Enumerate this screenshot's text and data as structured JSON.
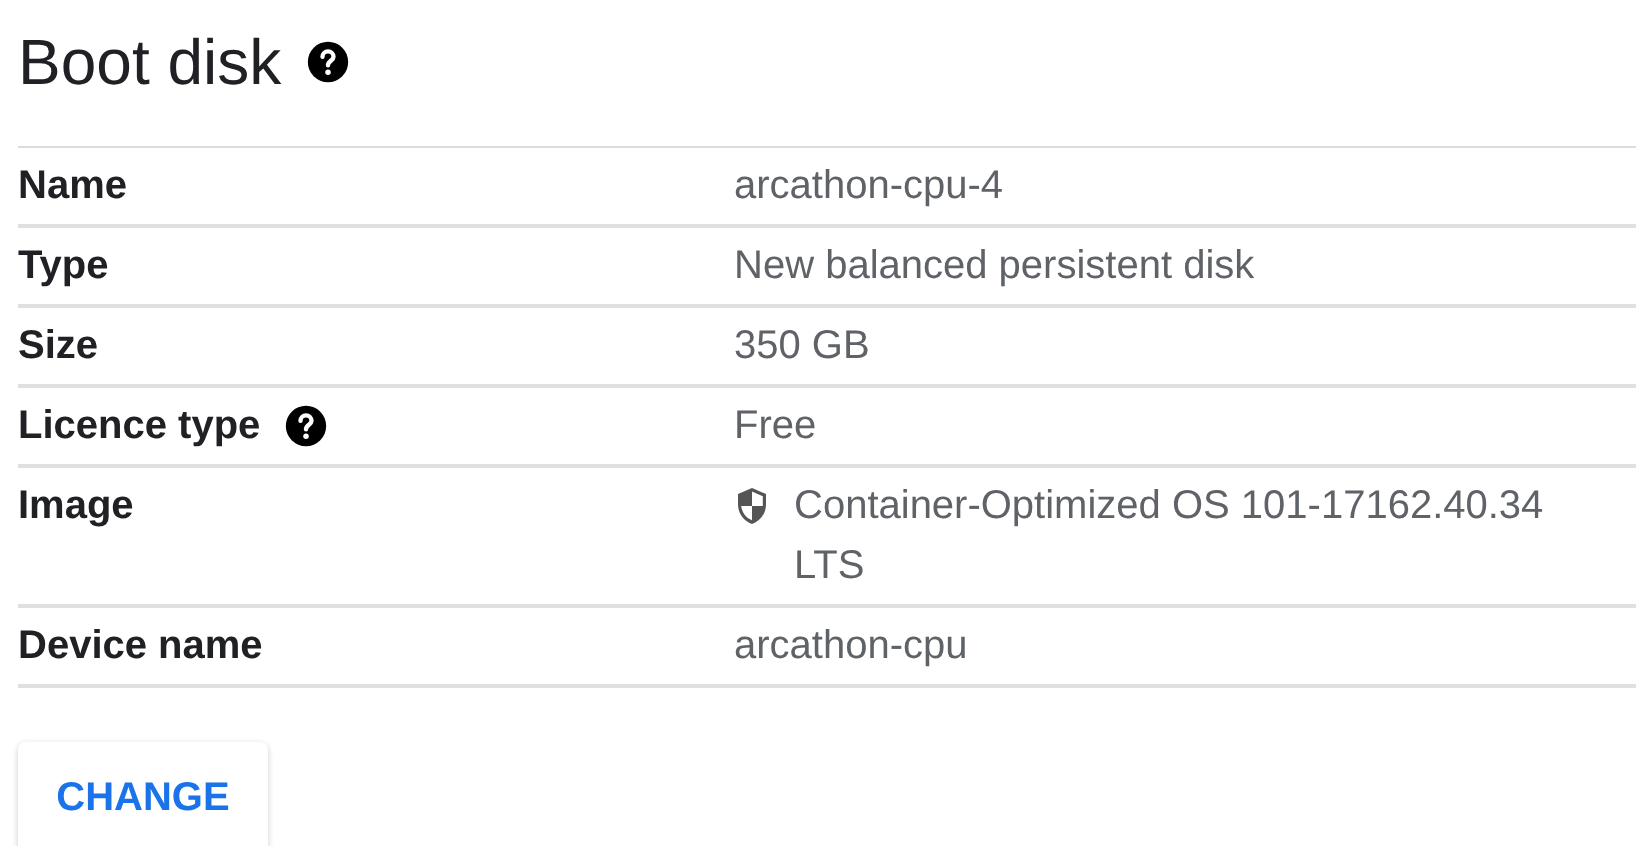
{
  "section": {
    "title": "Boot disk",
    "has_help": true
  },
  "rows": [
    {
      "label": "Name",
      "value": "arcathon-cpu-4",
      "has_help": false,
      "has_shield": false
    },
    {
      "label": "Type",
      "value": "New balanced persistent disk",
      "has_help": false,
      "has_shield": false
    },
    {
      "label": "Size",
      "value": "350 GB",
      "has_help": false,
      "has_shield": false
    },
    {
      "label": "Licence type",
      "value": "Free",
      "has_help": true,
      "has_shield": false
    },
    {
      "label": "Image",
      "value": "Container-Optimized OS 101-17162.40.34 LTS",
      "has_help": false,
      "has_shield": true
    },
    {
      "label": "Device name",
      "value": "arcathon-cpu",
      "has_help": false,
      "has_shield": false
    }
  ],
  "button": {
    "label": "CHANGE"
  }
}
